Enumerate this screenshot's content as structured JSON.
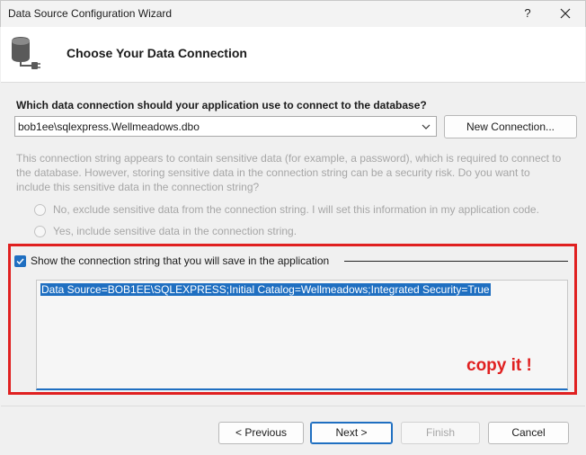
{
  "window": {
    "title": "Data Source Configuration Wizard",
    "help_glyph": "?",
    "close_icon": "close-icon"
  },
  "header": {
    "icon": "database-plug-icon",
    "heading": "Choose Your Data Connection"
  },
  "connection": {
    "question": "Which data connection should your application use to connect to the database?",
    "selected": "bob1ee\\sqlexpress.Wellmeadows.dbo",
    "new_button": "New Connection..."
  },
  "sensitive": {
    "info": "This connection string appears to contain sensitive data (for example, a password), which is required to connect to the database. However, storing sensitive data in the connection string can be a security risk. Do you want to include this sensitive data in the connection string?",
    "options": [
      {
        "label": "No, exclude sensitive data from the connection string. I will set this information in my application code."
      },
      {
        "label": "Yes, include sensitive data in the connection string."
      }
    ]
  },
  "show_string": {
    "label": "Show the connection string that you will save in the application",
    "checked": true,
    "value": "Data Source=BOB1EE\\SQLEXPRESS;Initial Catalog=Wellmeadows;Integrated Security=True",
    "annotation": "copy it !"
  },
  "footer": {
    "previous": "< Previous",
    "next": "Next >",
    "finish": "Finish",
    "cancel": "Cancel"
  },
  "colors": {
    "accent": "#1f6fc1",
    "annotation_red": "#e02020",
    "disabled_text": "#a6a6a6"
  }
}
